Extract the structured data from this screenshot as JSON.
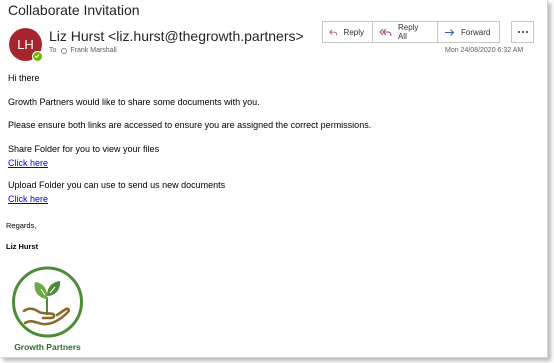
{
  "email": {
    "subject": "Collaborate Invitation",
    "avatar_initials": "LH",
    "sender": "Liz Hurst <liz.hurst@thegrowth.partners>",
    "to_label": "To",
    "recipient": "Frank Marshall",
    "date": "Mon 24/08/2020 6:32 AM"
  },
  "actions": {
    "reply": "Reply",
    "reply_all": "Reply All",
    "forward": "Forward"
  },
  "body": {
    "greeting": "Hi there",
    "line1": "Growth Partners would like to share some documents with you.",
    "line2": "Please ensure both links are accessed to ensure you are assigned the correct permissions.",
    "share_text": "Share Folder for you to view your files",
    "share_link": "Click here",
    "upload_text": "Upload Folder you can use to send us new documents",
    "upload_link": "Click here",
    "regards": "Regards,",
    "signature_name": "Liz Hurst"
  },
  "logo": {
    "text": "Growth Partners",
    "ring_color": "#4f8c3a",
    "leaf_color": "#6fa844",
    "hand_color": "#8a6a2c"
  },
  "colors": {
    "avatar": "#a4262c",
    "presence": "#6bb700",
    "link": "#0000ee",
    "action_icon": "#a1407c",
    "forward_icon": "#2b62a8"
  }
}
